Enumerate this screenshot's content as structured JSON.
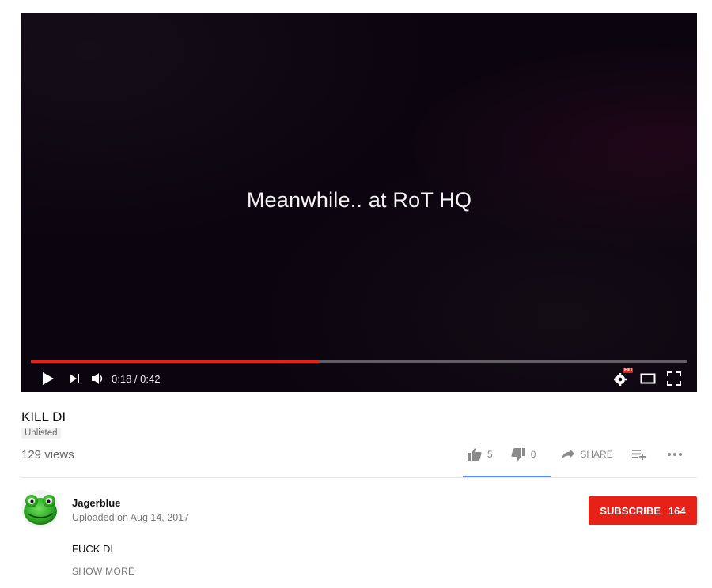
{
  "player": {
    "caption": "Meanwhile.. at RoT HQ",
    "progress_fraction": 0.44,
    "time_current": "0:18",
    "time_total": "0:42",
    "time_display": "0:18 / 0:42",
    "hd_badge": "HD",
    "colors": {
      "progress": "#e62117",
      "background": "#0b0510"
    }
  },
  "video": {
    "title": "KILL DI",
    "visibility": "Unlisted",
    "views": "129 views"
  },
  "actions": {
    "likes": "5",
    "dislikes": "0",
    "share_label": "SHARE",
    "like_bar_color": "#4f8ff7"
  },
  "channel": {
    "name": "Jagerblue",
    "uploaded": "Uploaded on Aug 14, 2017",
    "subscribe_label": "SUBSCRIBE",
    "subscriber_count": "164"
  },
  "description": {
    "text": "FUCK DI",
    "show_more": "SHOW MORE"
  },
  "icons": [
    "play-icon",
    "next-icon",
    "volume-icon",
    "settings-icon",
    "theater-icon",
    "fullscreen-icon",
    "thumbs-up-icon",
    "thumbs-down-icon",
    "share-icon",
    "add-to-playlist-icon",
    "more-icon"
  ]
}
